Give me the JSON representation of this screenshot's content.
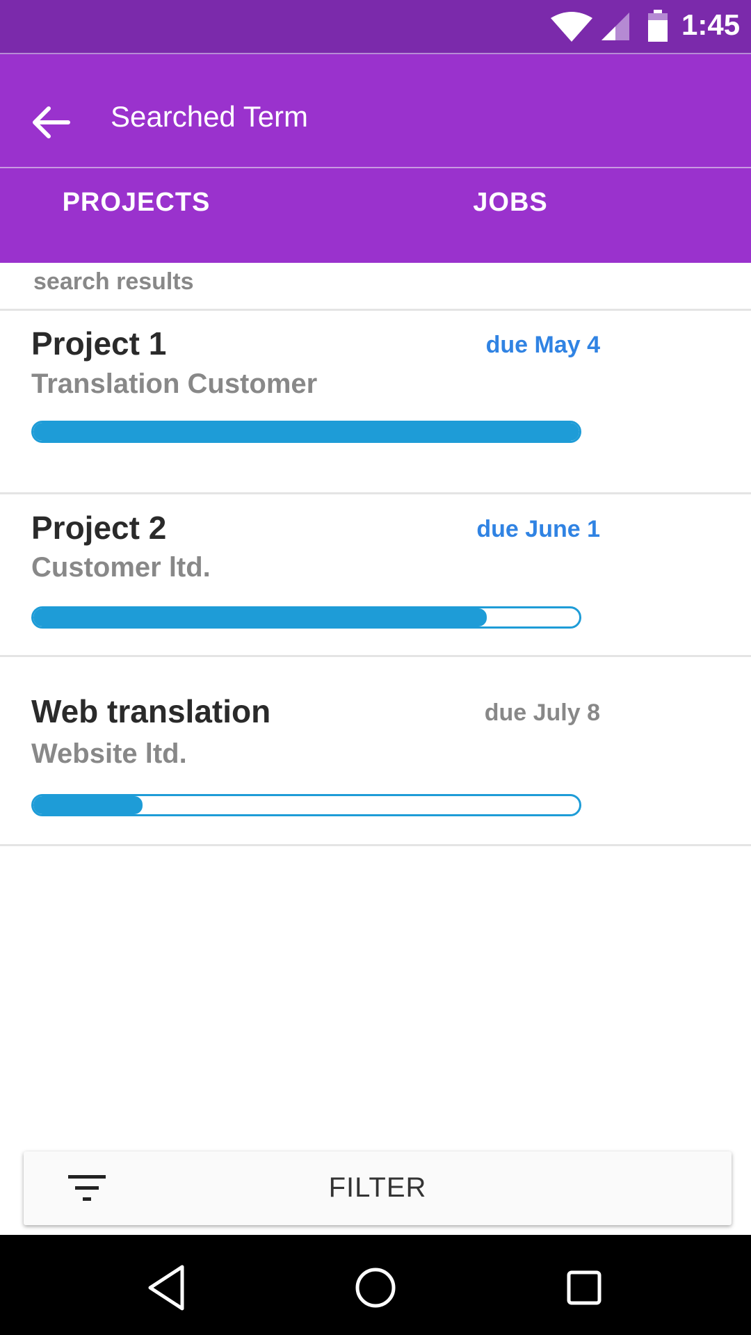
{
  "status_bar": {
    "time": "1:45",
    "icons": [
      "wifi-icon",
      "signal-icon",
      "battery-icon"
    ]
  },
  "app_bar": {
    "title": "Searched Term",
    "back_icon": "arrow-left-icon"
  },
  "tabs": [
    {
      "label": "PROJECTS"
    },
    {
      "label": "JOBS"
    }
  ],
  "search_results_label": "search results",
  "projects": [
    {
      "name": "Project 1",
      "customer": "Translation Customer",
      "due": "due May 4",
      "due_color": "#3083e3",
      "progress": 1.0
    },
    {
      "name": "Project 2",
      "customer": "Customer ltd.",
      "due": "due June 1",
      "due_color": "#3083e3",
      "progress": 0.83
    },
    {
      "name": "Web translation",
      "customer": "Website ltd.",
      "due": "due July 8",
      "due_color": "#888888",
      "progress": 0.2
    }
  ],
  "filter": {
    "label": "FILTER",
    "icon": "filter-icon"
  },
  "colors": {
    "status_bar": "#7b2aab",
    "app_bar": "#9a32cd",
    "progress": "#1e9cd7",
    "due_accent": "#3083e3"
  },
  "nav_bar": {
    "icons": [
      "back-triangle-icon",
      "home-circle-icon",
      "recents-square-icon"
    ]
  }
}
